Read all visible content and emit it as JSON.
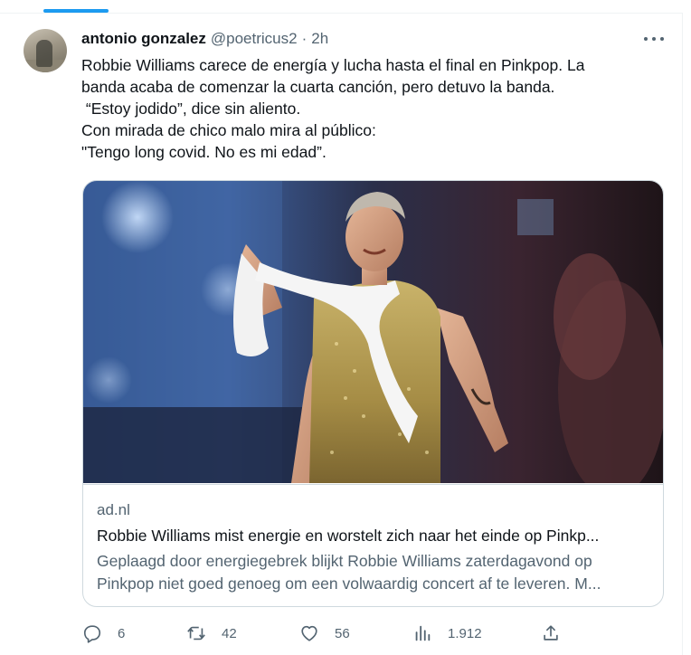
{
  "colors": {
    "accent": "#1d9bf0",
    "text": "#0f1419",
    "secondary": "#536471",
    "border": "#cfd9de"
  },
  "tweet": {
    "author_name": "antonio gonzalez",
    "handle": "@poetricus2",
    "separator": "·",
    "time": "2h",
    "text_lines": [
      "Robbie Williams carece de energía y lucha hasta el final en Pinkpop. La",
      "banda acaba de comenzar la cuarta canción, pero detuvo la banda.",
      " “Estoy jodido”, dice sin aliento.",
      "Con mirada de chico malo mira al público:",
      "\"Tengo long covid. No es mi edad”."
    ],
    "more_icon": "ellipsis-icon"
  },
  "card": {
    "domain": "ad.nl",
    "title": "Robbie Williams mist energie en worstelt zich naar het einde op Pinkp...",
    "description_lines": [
      "Geplaagd door energiegebrek blijkt Robbie Williams zaterdagavond op",
      "Pinkpop niet goed genoeg om een volwaardig concert af te leveren. M..."
    ]
  },
  "actions": {
    "reply": {
      "icon": "reply-icon",
      "count": "6"
    },
    "retweet": {
      "icon": "retweet-icon",
      "count": "42"
    },
    "like": {
      "icon": "heart-icon",
      "count": "56"
    },
    "views": {
      "icon": "views-icon",
      "count": "1.912"
    },
    "share": {
      "icon": "share-icon"
    }
  }
}
